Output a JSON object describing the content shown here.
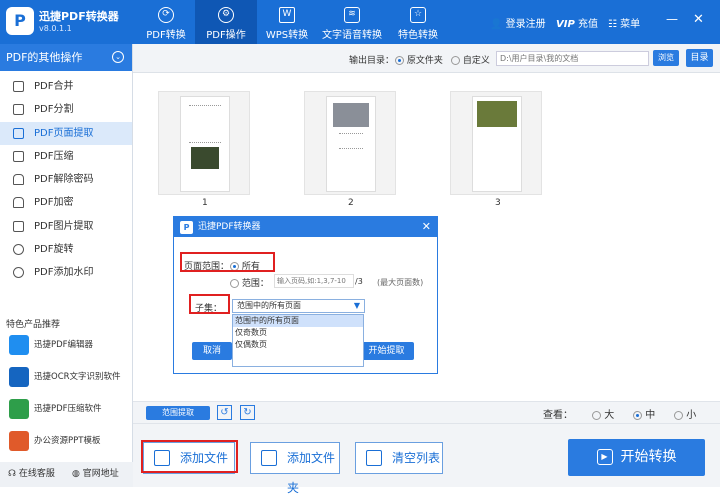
{
  "app": {
    "logo_letter": "P",
    "name": "迅捷PDF转换器",
    "version": "v8.0.1.1"
  },
  "nav": [
    {
      "label": "PDF转换",
      "icon": "refresh-icon"
    },
    {
      "label": "PDF操作",
      "icon": "gear-icon"
    },
    {
      "label": "WPS转换",
      "icon": "w-doc-icon"
    },
    {
      "label": "文字语音转换",
      "icon": "waveform-icon"
    },
    {
      "label": "特色转换",
      "icon": "star-icon"
    }
  ],
  "topright": {
    "login": "登录注册",
    "vip": "VIP",
    "recharge": "充值",
    "menu": "菜单"
  },
  "sidebar": {
    "header": "PDF的其他操作",
    "items": [
      {
        "label": "PDF合并"
      },
      {
        "label": "PDF分割"
      },
      {
        "label": "PDF页面提取"
      },
      {
        "label": "PDF压缩"
      },
      {
        "label": "PDF解除密码"
      },
      {
        "label": "PDF加密"
      },
      {
        "label": "PDF图片提取"
      },
      {
        "label": "PDF旋转"
      },
      {
        "label": "PDF添加水印"
      }
    ],
    "recommend_title": "特色产品推荐",
    "products": [
      {
        "label": "迅捷PDF编辑器",
        "color": "#1f8ef0"
      },
      {
        "label": "迅捷OCR文字识别软件",
        "color": "#1565c0"
      },
      {
        "label": "迅捷PDF压缩软件",
        "color": "#2e9e4a"
      },
      {
        "label": "办公资源PPT模板",
        "color": "#e05a2a"
      }
    ],
    "footer": {
      "service": "在线客服",
      "website": "官网地址"
    }
  },
  "outbar": {
    "label": "输出目录：",
    "opt_original": "原文件夹",
    "opt_custom": "自定义",
    "path_placeholder": "D:\\用户目录\\我的文档",
    "browse": "浏览",
    "directory": "目录"
  },
  "thumbnails": [
    {
      "num": "1"
    },
    {
      "num": "2"
    },
    {
      "num": "3"
    }
  ],
  "dialog": {
    "title": "迅捷PDF转换器",
    "close": "✕",
    "range_label": "页面范围：",
    "opt_all": "所有",
    "opt_range": "范围：",
    "range_placeholder": "输入页码,如:1,3,7-10",
    "range_total": "/3",
    "range_max": "(最大页面数)",
    "subset_label": "子集：",
    "subset_selected": "范围中的所有页面",
    "subset_options": [
      "范围中的所有页面",
      "仅奇数页",
      "仅偶数页"
    ],
    "cancel": "取消",
    "extract": "开始提取"
  },
  "toolstrip": {
    "range_extract": "范围提取",
    "view_label": "查看：",
    "view_large": "大",
    "view_medium": "中",
    "view_small": "小"
  },
  "bottom": {
    "add_file": "添加文件",
    "add_folder": "添加文件夹",
    "clear_list": "清空列表",
    "start": "开始转换"
  }
}
